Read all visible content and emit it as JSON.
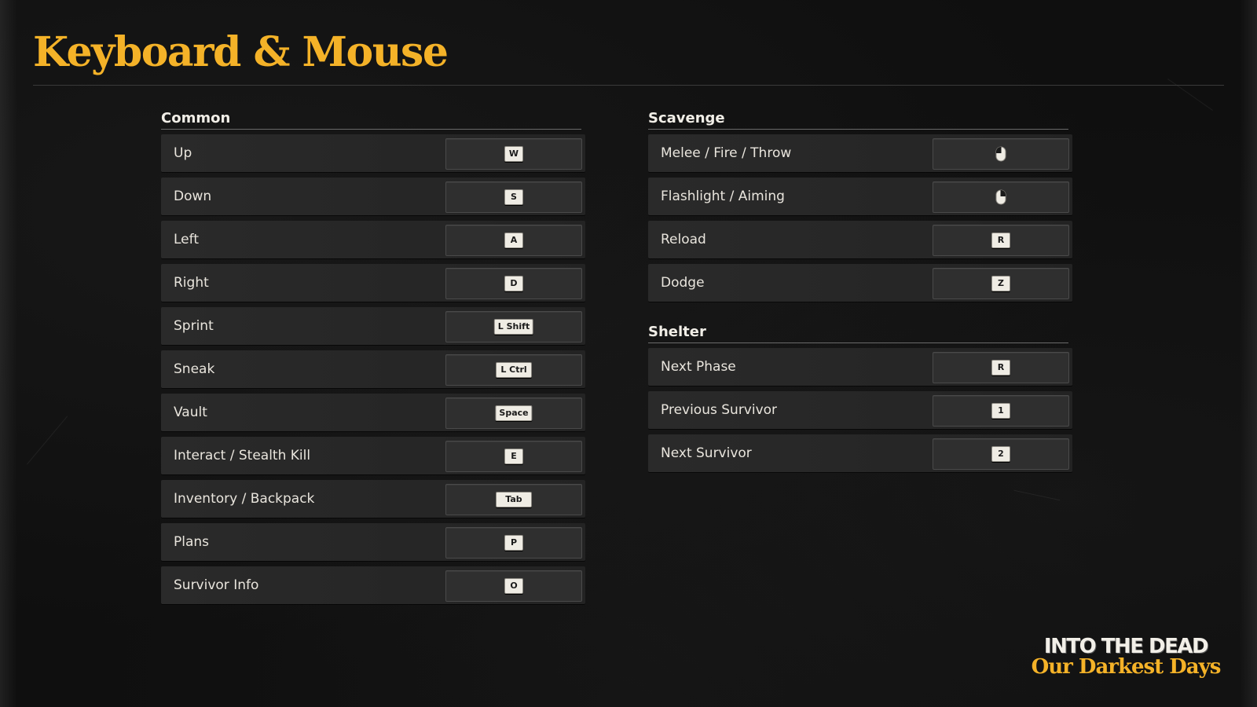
{
  "title": "Keyboard & Mouse",
  "colors": {
    "accent": "#f4b228",
    "background": "#0f0f0f",
    "row": "#2a2a2a",
    "keycap": "#efece4"
  },
  "sections": {
    "common": {
      "title": "Common",
      "items": [
        {
          "label": "Up",
          "key": "W"
        },
        {
          "label": "Down",
          "key": "S"
        },
        {
          "label": "Left",
          "key": "A"
        },
        {
          "label": "Right",
          "key": "D"
        },
        {
          "label": "Sprint",
          "key": "L Shift"
        },
        {
          "label": "Sneak",
          "key": "L Ctrl"
        },
        {
          "label": "Vault",
          "key": "Space"
        },
        {
          "label": "Interact / Stealth Kill",
          "key": "E"
        },
        {
          "label": "Inventory / Backpack",
          "key": "Tab"
        },
        {
          "label": "Plans",
          "key": "P"
        },
        {
          "label": "Survivor Info",
          "key": "O"
        }
      ]
    },
    "scavenge": {
      "title": "Scavenge",
      "items": [
        {
          "label": "Melee / Fire / Throw",
          "icon": "left-mouse-button-icon"
        },
        {
          "label": "Flashlight / Aiming",
          "icon": "right-mouse-button-icon"
        },
        {
          "label": "Reload",
          "key": "R"
        },
        {
          "label": "Dodge",
          "key": "Z"
        }
      ]
    },
    "shelter": {
      "title": "Shelter",
      "items": [
        {
          "label": "Next Phase",
          "key": "R"
        },
        {
          "label": "Previous Survivor",
          "key": "1"
        },
        {
          "label": "Next Survivor",
          "key": "2"
        }
      ]
    }
  },
  "brand": {
    "line1": "INTO THE DEAD",
    "line2": "Our Darkest Days"
  }
}
